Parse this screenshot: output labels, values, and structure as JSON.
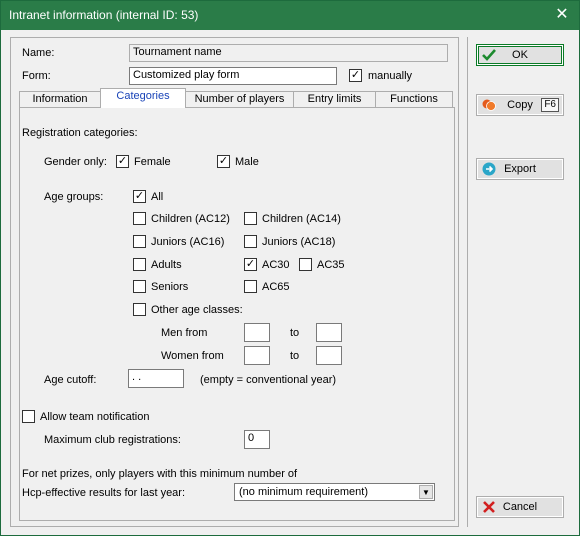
{
  "window": {
    "title": "Intranet information (internal ID: 53)"
  },
  "header": {
    "name_label": "Name:",
    "name_value": "Tournament name",
    "form_label": "Form:",
    "form_value": "Customized play form",
    "manually_label": "manually",
    "manually_checked": true
  },
  "tabs": [
    "Information",
    "Categories",
    "Number of players",
    "Entry limits",
    "Functions"
  ],
  "active_tab": "Categories",
  "categories": {
    "registration_label": "Registration categories:",
    "gender_label": "Gender only:",
    "gender": [
      {
        "label": "Female",
        "checked": true
      },
      {
        "label": "Male",
        "checked": true
      }
    ],
    "age_label": "Age groups:",
    "age_all": {
      "label": "All",
      "checked": true
    },
    "age_groups": [
      {
        "label": "Children (AC12)",
        "checked": false
      },
      {
        "label": "Children (AC14)",
        "checked": false
      },
      {
        "label": "Juniors (AC16)",
        "checked": false
      },
      {
        "label": "Juniors (AC18)",
        "checked": false
      },
      {
        "label": "Adults",
        "checked": false
      },
      {
        "label": "AC30",
        "checked": true
      },
      {
        "label": "AC35",
        "checked": false
      },
      {
        "label": "Seniors",
        "checked": false
      },
      {
        "label": "AC65",
        "checked": false
      }
    ],
    "other_age": {
      "label": "Other age classes:",
      "checked": false
    },
    "men_from": "Men from",
    "women_from": "Women from",
    "to": "to",
    "age_cutoff_label": "Age cutoff:",
    "age_cutoff_value": " .  .",
    "age_cutoff_hint": "(empty = conventional year)",
    "team_notification": {
      "label": "Allow team notification",
      "checked": false
    },
    "max_club_label": "Maximum club registrations:",
    "max_club_value": "0",
    "net_prize_text": "For net prizes, only players with this minimum number of",
    "hcp_label": "Hcp-effective results for last year:",
    "hcp_value": "(no minimum requirement)"
  },
  "buttons": {
    "ok": "OK",
    "copy": "Copy",
    "copy_key": "F6",
    "export": "Export",
    "cancel": "Cancel"
  },
  "colors": {
    "titlebar": "#2a7c48",
    "active_tab_text": "#1a44b8",
    "ok_check": "#1c8a2e",
    "cancel_x": "#d21f1f"
  }
}
